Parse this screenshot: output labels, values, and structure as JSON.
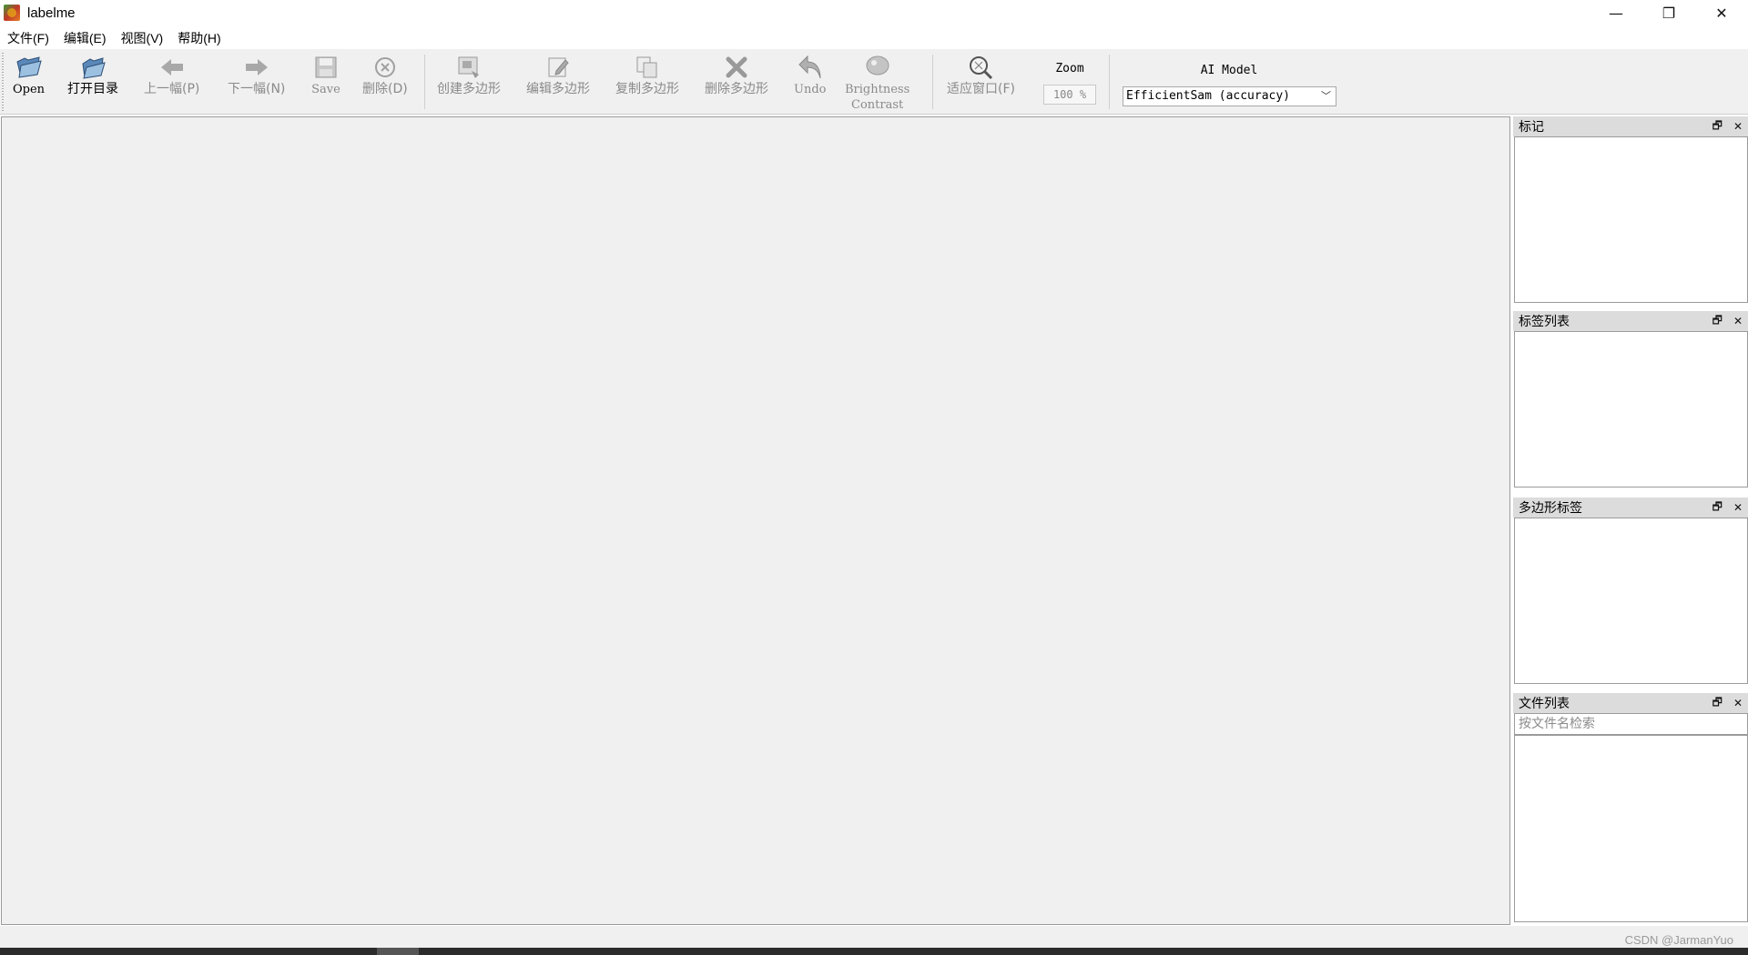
{
  "window": {
    "title": "labelme",
    "minimize": "—",
    "maximize": "❐",
    "close": "✕"
  },
  "menu": [
    "文件(F)",
    "编辑(E)",
    "视图(V)",
    "帮助(H)"
  ],
  "toolbar": {
    "open": "Open",
    "open_dir": "打开目录",
    "prev": "上一幅(P)",
    "next": "下一幅(N)",
    "save": "Save",
    "delete": "删除(D)",
    "create_polygon": "创建多边形",
    "edit_polygon": "编辑多边形",
    "copy_polygon": "复制多边形",
    "delete_polygon": "删除多边形",
    "undo": "Undo",
    "brightness": "Brightness",
    "contrast": "Contrast",
    "fit_window": "适应窗口(F)",
    "zoom_label": "Zoom",
    "zoom_value": "100 %",
    "ai_label": "AI Model",
    "ai_model": "EfficientSam (accuracy)"
  },
  "docks": {
    "flags": {
      "title": "标记"
    },
    "labels": {
      "title": "标签列表"
    },
    "polygons": {
      "title": "多边形标签"
    },
    "files": {
      "title": "文件列表",
      "search_placeholder": "按文件名检索"
    }
  },
  "watermark": "CSDN @JarmanYuo",
  "colors": {
    "toolbar_bg": "#f0f0f0",
    "canvas_bg": "#f0f0f0",
    "dock_header": "#dcdcdc",
    "disabled_text": "#8a8a8a"
  }
}
